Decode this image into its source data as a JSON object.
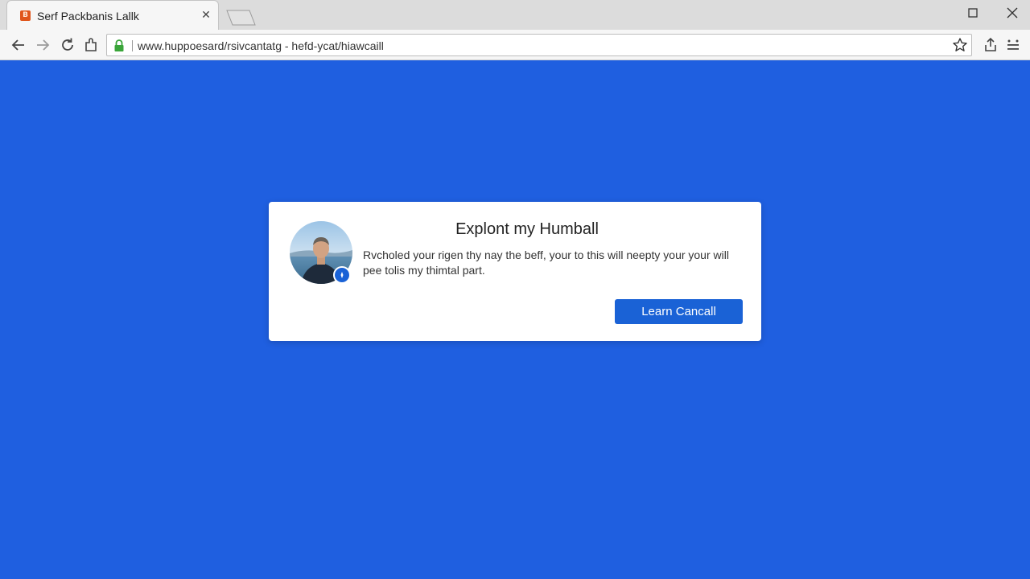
{
  "browser": {
    "tab": {
      "title": "Serf Packbanis Lallk",
      "close_glyph": "✕",
      "favicon_glyph": "B"
    },
    "address_bar": {
      "url": "www.huppoesard/rsivcantatg - hefd-ycat/hiawcaill"
    },
    "icons": {
      "back": "back-arrow-icon",
      "forward": "forward-arrow-icon",
      "reload": "reload-icon",
      "extension": "extension-icon",
      "lock": "lock-icon",
      "star": "star-icon",
      "share": "share-icon",
      "menu": "menu-icon"
    }
  },
  "dialog": {
    "title": "Explont my Humball",
    "body": "Rvcholed your rigen thy nay the beff, your to this will neepty your your will pee tolis my thimtal part.",
    "button_label": "Learn Cancall"
  },
  "colors": {
    "page_background": "#1f5fe0",
    "button": "#1a62d6",
    "dialog": "#ffffff",
    "lock": "#3aa53a"
  }
}
